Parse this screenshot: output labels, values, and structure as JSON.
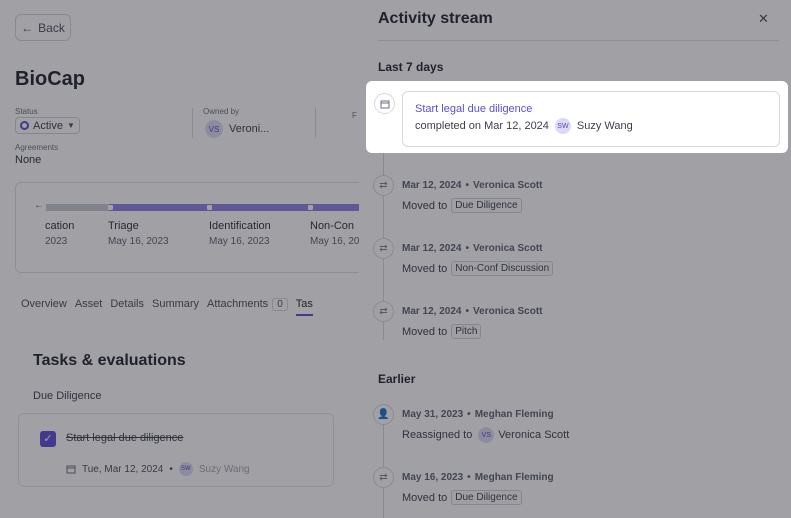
{
  "page": {
    "back_label": "Back",
    "title": "BioCap",
    "status_label": "Status",
    "status_value": "Active",
    "owned_by_label": "Owned by",
    "owner_initials": "VS",
    "owner_name": "Veroni...",
    "cut_label": "F",
    "agreements_label": "Agreements",
    "agreements_value": "None",
    "pipeline": {
      "stages": [
        {
          "name": "cation",
          "date": "2023"
        },
        {
          "name": "Triage",
          "date": "May 16, 2023"
        },
        {
          "name": "Identification",
          "date": "May 16, 2023"
        },
        {
          "name": "Non-Con",
          "date": "May 16, 20"
        }
      ]
    },
    "tabs": [
      {
        "label": "Overview"
      },
      {
        "label": "Asset"
      },
      {
        "label": "Details"
      },
      {
        "label": "Summary"
      },
      {
        "label": "Attachments",
        "count": "0"
      },
      {
        "label": "Tas"
      }
    ],
    "tasks_title": "Tasks & evaluations",
    "group_label": "Due Diligence",
    "task": {
      "title": "Start legal due diligence",
      "date": "Tue, Mar 12, 2024",
      "assignee_initials": "SW",
      "assignee_name": "Suzy Wang"
    }
  },
  "drawer": {
    "title": "Activity stream",
    "section_recent": "Last 7 days",
    "section_earlier": "Earlier",
    "highlight": {
      "link": "Start legal due diligence",
      "desc": "completed on Mar 12, 2024",
      "initials": "SW",
      "name": "Suzy Wang"
    },
    "recent": [
      {
        "date": "Mar 12, 2024",
        "user": "Veronica Scott",
        "action": "Moved to",
        "target": "Due Diligence"
      },
      {
        "date": "Mar 12, 2024",
        "user": "Veronica Scott",
        "action": "Moved to",
        "target": "Non-Conf Discussion"
      },
      {
        "date": "Mar 12, 2024",
        "user": "Veronica Scott",
        "action": "Moved to",
        "target": "Pitch"
      }
    ],
    "earlier": [
      {
        "date": "May 31, 2023",
        "user": "Meghan Fleming",
        "action": "Reassigned to",
        "initials": "VS",
        "target": "Veronica Scott"
      },
      {
        "date": "May 16, 2023",
        "user": "Meghan Fleming",
        "action": "Moved to",
        "target": "Due Diligence"
      }
    ]
  }
}
